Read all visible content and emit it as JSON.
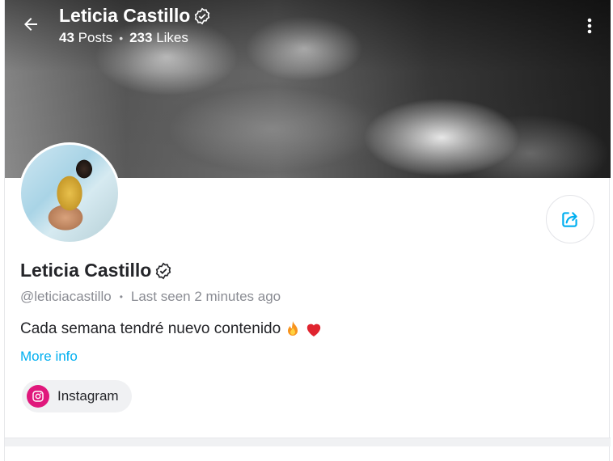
{
  "header": {
    "name": "Leticia Castillo",
    "posts_count": "43",
    "posts_label": "Posts",
    "likes_count": "233",
    "likes_label": "Likes",
    "separator": "•"
  },
  "profile": {
    "name": "Leticia Castillo",
    "handle": "@leticiacastillo",
    "separator": "•",
    "last_seen": "Last seen 2 minutes ago",
    "bio": "Cada semana tendré nuevo contenido",
    "bio_emojis": [
      "fire-emoji",
      "heart-emoji"
    ],
    "more_info_label": "More info"
  },
  "social": {
    "label": "Instagram",
    "icon": "instagram-icon"
  },
  "icons": {
    "back": "arrow-left-icon",
    "more": "more-vertical-icon",
    "verified": "verified-badge-icon",
    "share": "share-icon"
  },
  "colors": {
    "accent": "#00aff0",
    "instagram": "#e0187c",
    "text": "#242529",
    "muted": "#8a8c93"
  }
}
